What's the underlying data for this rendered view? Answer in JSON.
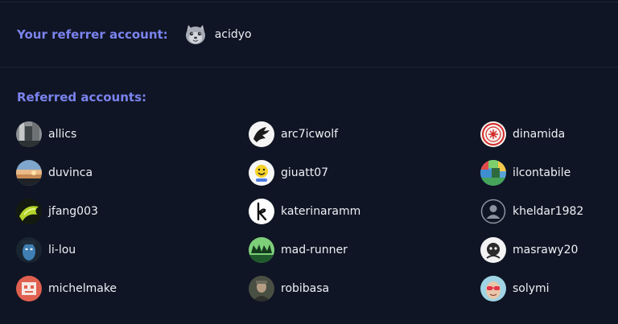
{
  "referrer": {
    "label": "Your referrer account:",
    "account": {
      "username": "acidyo",
      "avatar": "wolf-mascot-avatar"
    }
  },
  "referred": {
    "label": "Referred accounts:",
    "accounts": [
      {
        "username": "allics",
        "avatar": "photo-avatar"
      },
      {
        "username": "arc7icwolf",
        "avatar": "wolf-logo-avatar"
      },
      {
        "username": "dinamida",
        "avatar": "red-seal-avatar"
      },
      {
        "username": "duvinca",
        "avatar": "sunset-avatar"
      },
      {
        "username": "giuatt07",
        "avatar": "emoji-avatar"
      },
      {
        "username": "ilcontabile",
        "avatar": "pixel-avatar"
      },
      {
        "username": "jfang003",
        "avatar": "green-art-avatar"
      },
      {
        "username": "katerinaramm",
        "avatar": "letter-k-avatar"
      },
      {
        "username": "kheldar1982",
        "avatar": "default-user-avatar"
      },
      {
        "username": "li-lou",
        "avatar": "blue-character-avatar"
      },
      {
        "username": "mad-runner",
        "avatar": "mad-logo-avatar"
      },
      {
        "username": "masrawy20",
        "avatar": "cartoon-avatar"
      },
      {
        "username": "michelmake",
        "avatar": "robot-avatar"
      },
      {
        "username": "robibasa",
        "avatar": "portrait-avatar"
      },
      {
        "username": "solymi",
        "avatar": "sunglasses-avatar"
      }
    ]
  },
  "colors": {
    "background": "#0f1524",
    "accent": "#7b83ee",
    "divider": "#1e2536",
    "text": "#eef0f5"
  }
}
